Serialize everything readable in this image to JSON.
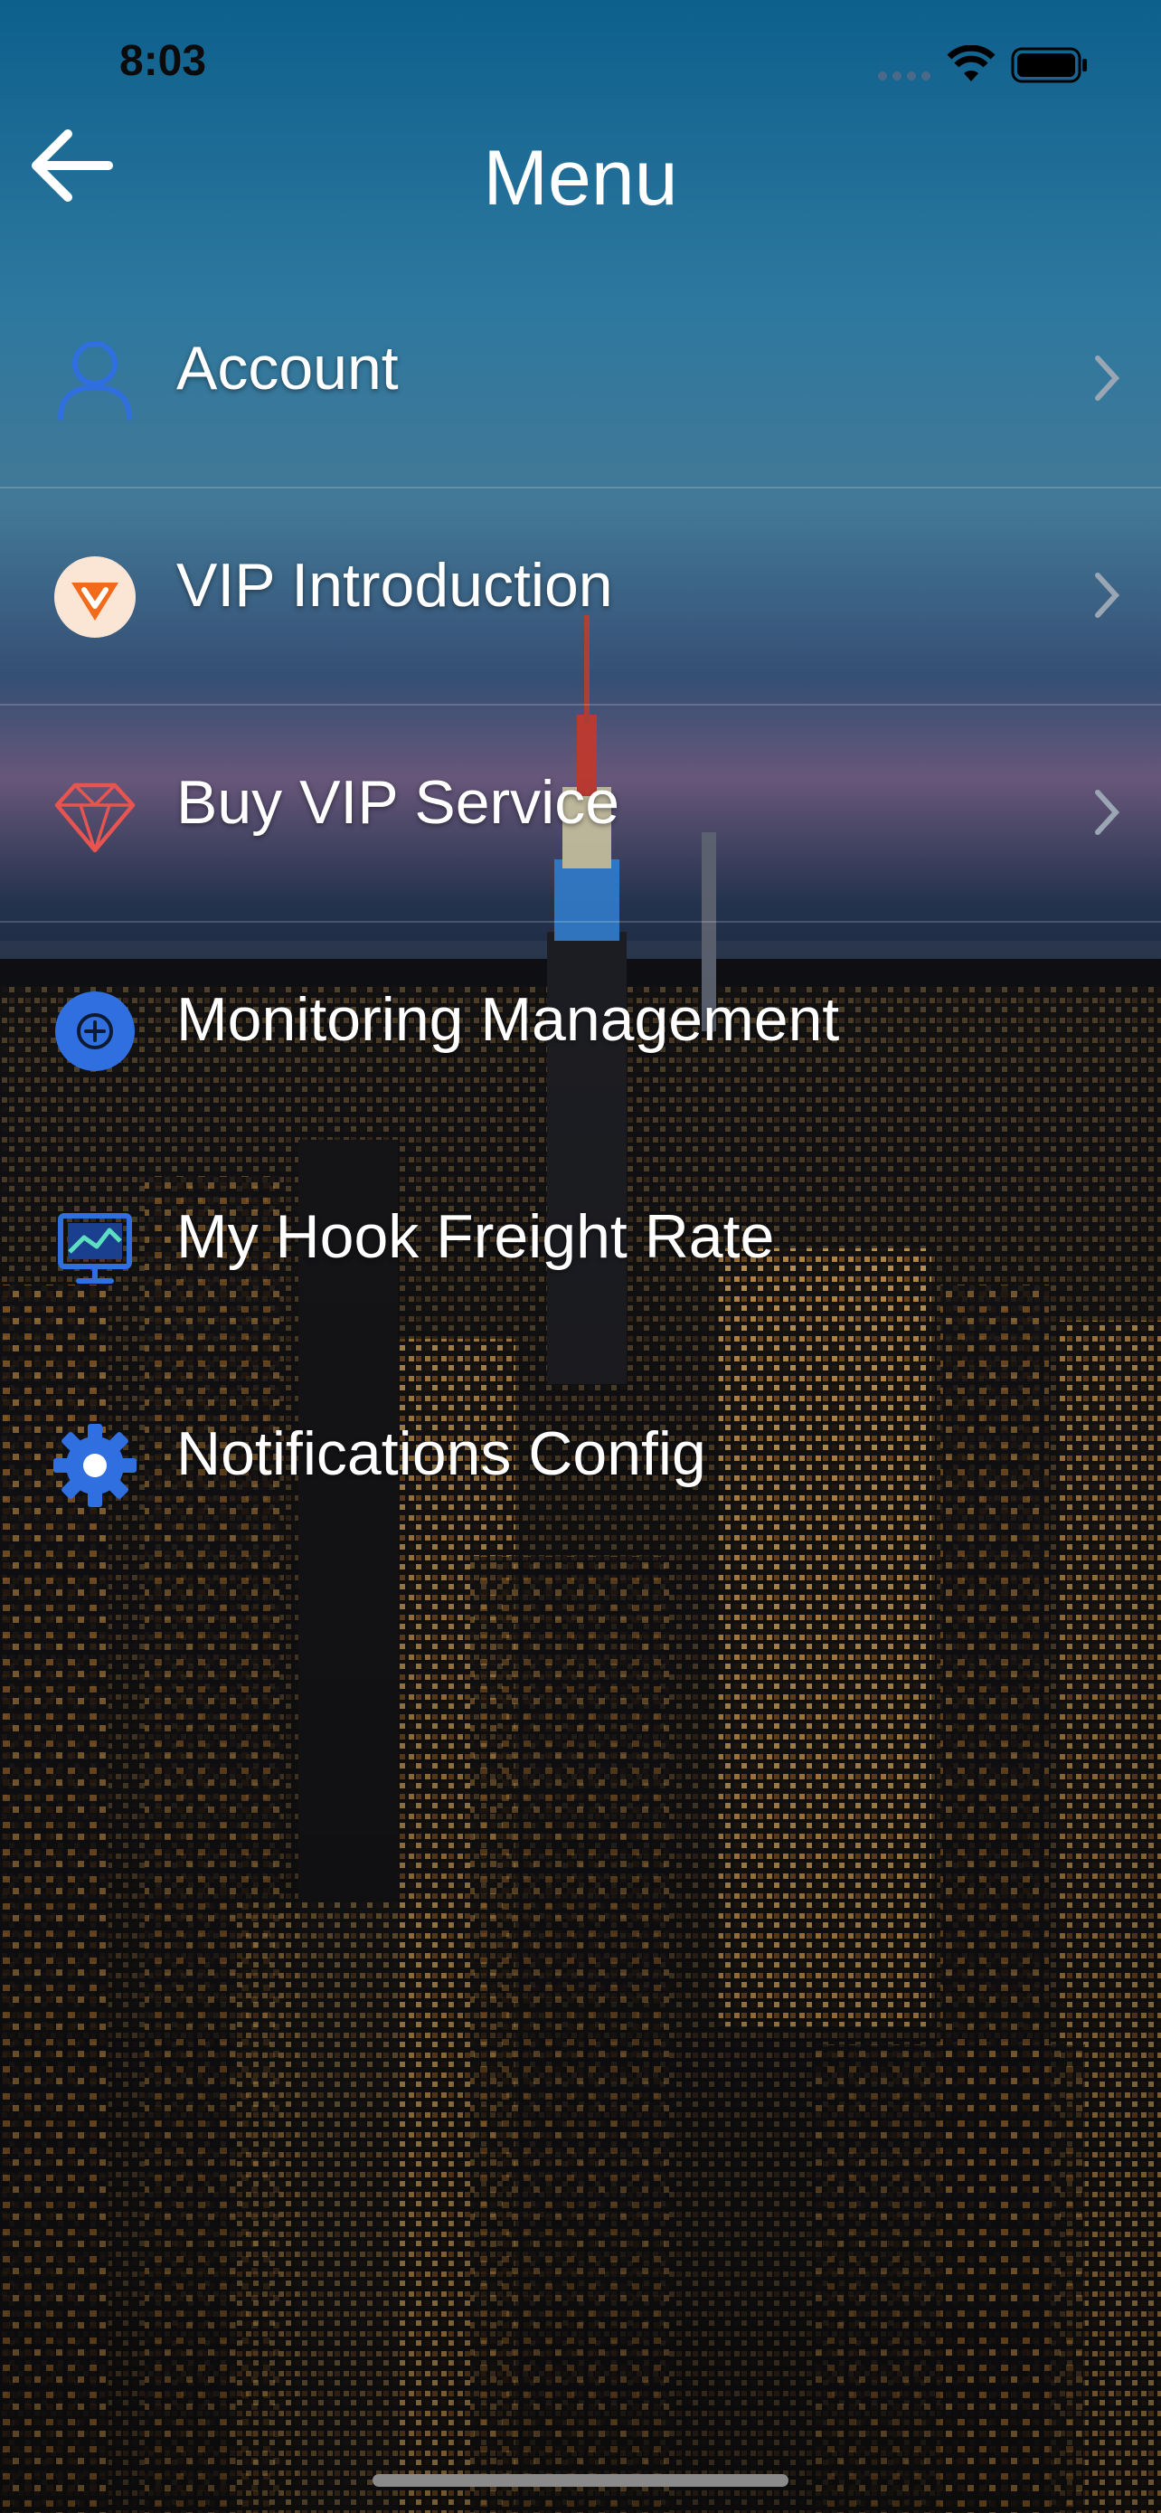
{
  "status_bar": {
    "time": "8:03"
  },
  "header": {
    "title": "Menu"
  },
  "menu": {
    "items": [
      {
        "label": "Account",
        "icon": "user-icon",
        "has_chevron": true
      },
      {
        "label": "VIP Introduction",
        "icon": "vip-badge-icon",
        "has_chevron": true
      },
      {
        "label": "Buy VIP Service",
        "icon": "diamond-icon",
        "has_chevron": true
      },
      {
        "label": "Monitoring Management",
        "icon": "monitoring-icon",
        "has_chevron": false
      },
      {
        "label": "My Hook Freight Rate",
        "icon": "chart-monitor-icon",
        "has_chevron": false
      },
      {
        "label": "Notifications Config",
        "icon": "gear-icon",
        "has_chevron": false
      }
    ]
  },
  "colors": {
    "accent_blue": "#2f6fe0",
    "vip_orange": "#f26a1b",
    "diamond_red": "#e8544f",
    "text": "#ffffff"
  }
}
